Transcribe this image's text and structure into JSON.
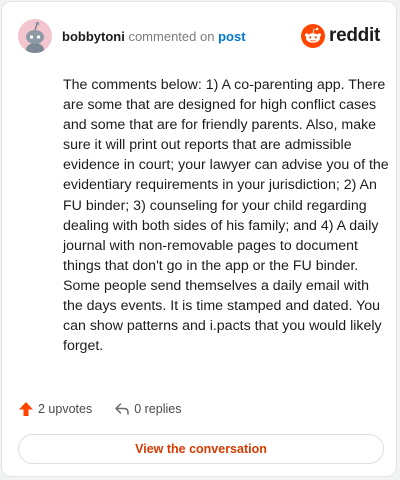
{
  "header": {
    "username": "bobbytoni",
    "verb": "commented on",
    "post_link": "post",
    "brand": "reddit"
  },
  "comment": {
    "text": "The comments below: 1) A co-parenting app. There are some that are designed for high conflict cases and some that are for friendly parents. Also, make sure it will print out reports that are admissible evidence in court; your lawyer can advise you of the evidentiary requirements in your jurisdiction; 2) An FU binder; 3) counseling for your child regarding dealing with both sides of his family; and 4) A daily journal with non-removable pages to document things that don't go in the app or the FU binder. Some people send themselves a daily email with the days events. It is time stamped and dated. You can show patterns and i.pacts that you would likely forget."
  },
  "actions": {
    "upvotes": "2 upvotes",
    "replies": "0 replies"
  },
  "cta_label": "View the conversation",
  "colors": {
    "accent_orange": "#ff4500",
    "link_blue": "#0079d3",
    "cta_text": "#d93a00",
    "avatar_bg": "#f3c6cf"
  },
  "icons": [
    "snoo-avatar-icon",
    "reddit-logo-icon",
    "upvote-arrow-icon",
    "reply-arrow-icon"
  ]
}
